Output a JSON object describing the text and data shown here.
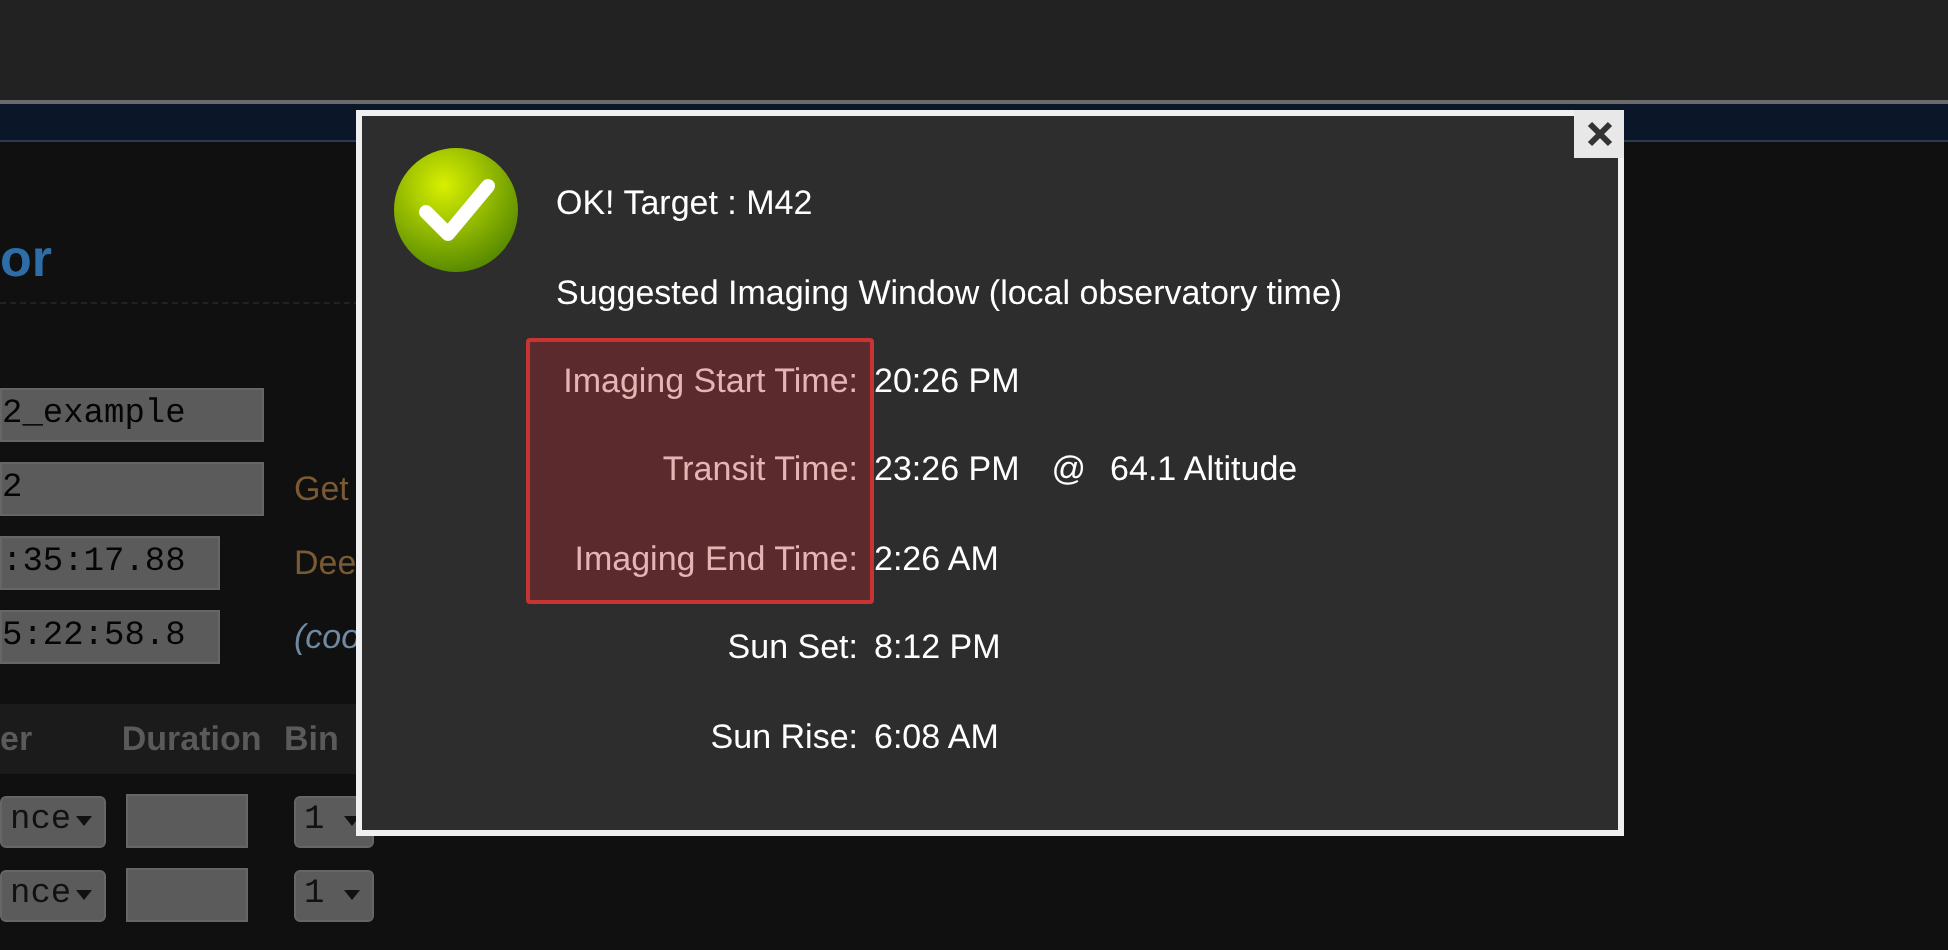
{
  "page": {
    "heading": "or",
    "fields": [
      {
        "value": "2_example",
        "wide": true
      },
      {
        "value": "2",
        "wide": true,
        "note": "Get"
      },
      {
        "value": ":35:17.88",
        "wide": false,
        "note": "Dee"
      },
      {
        "value": "5:22:58.8",
        "wide": false,
        "note": "(coo",
        "italic": true
      }
    ],
    "table": {
      "columns": [
        "er",
        "Duration",
        "Bin"
      ],
      "rows": [
        {
          "filter": "nce",
          "binning": "1"
        },
        {
          "filter": "nce",
          "binning": "1"
        }
      ]
    }
  },
  "dialog": {
    "title": "OK! Target : M42",
    "subtitle": "Suggested Imaging Window (local observatory time)",
    "rows": [
      {
        "label": "Imaging Start Time:",
        "value": "20:26 PM",
        "highlighted": true
      },
      {
        "label": "Transit Time:",
        "value": "23:26 PM",
        "highlighted": true,
        "at": "@",
        "altitude": "64.1 Altitude"
      },
      {
        "label": "Imaging End Time:",
        "value": "2:26 AM",
        "highlighted": true
      },
      {
        "label": "Sun Set:",
        "value": "8:12 PM",
        "highlighted": false
      },
      {
        "label": "Sun Rise:",
        "value": "6:08 AM",
        "highlighted": false
      }
    ]
  }
}
